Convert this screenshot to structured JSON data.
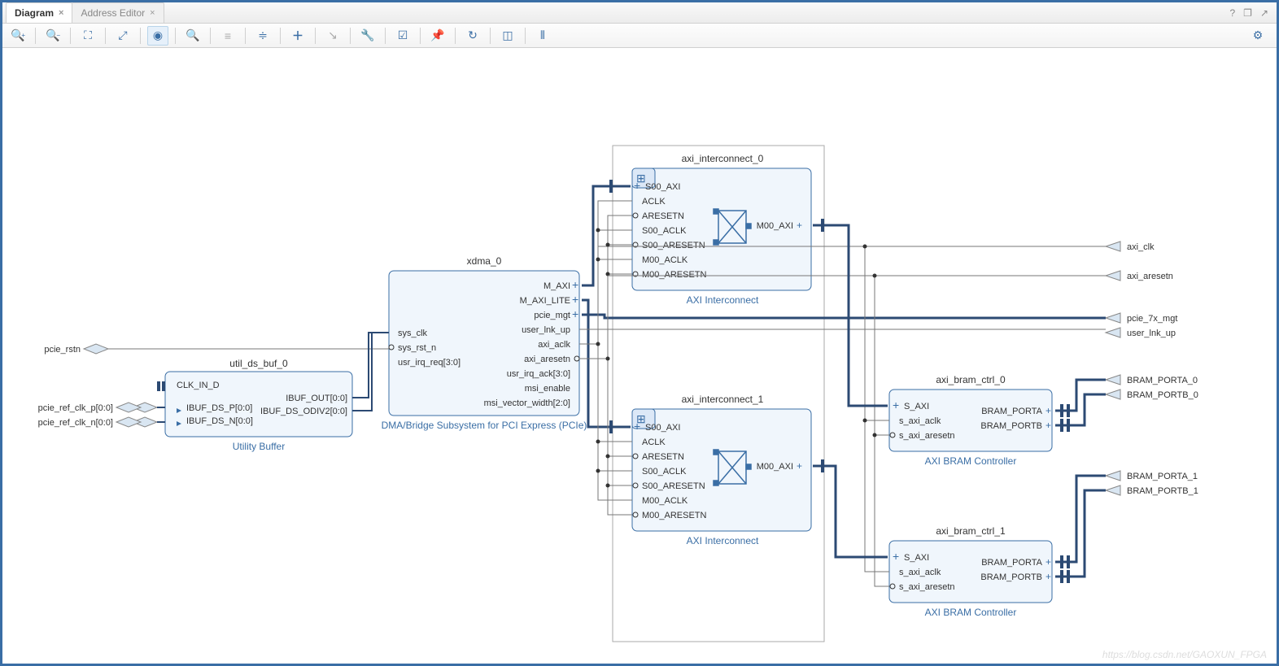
{
  "tabs": [
    {
      "label": "Diagram",
      "active": true
    },
    {
      "label": "Address Editor",
      "active": false
    }
  ],
  "toolbar": {
    "titles": [
      "Zoom In",
      "Zoom Out",
      "Fit",
      "Expand",
      "Center",
      "Search",
      "Collapse",
      "Arrange",
      "Add IP",
      "Connect",
      "Settings",
      "Validate",
      "Pin",
      "Refresh",
      "Highlight",
      "Group"
    ],
    "gear": "Settings"
  },
  "ext_ports": {
    "pcie_rstn": "pcie_rstn",
    "pcie_ref_clk_p": "pcie_ref_clk_p[0:0]",
    "pcie_ref_clk_n": "pcie_ref_clk_n[0:0]",
    "axi_clk": "axi_clk",
    "axi_aresetn": "axi_aresetn",
    "pcie_7x_mgt": "pcie_7x_mgt",
    "user_lnk_up": "user_lnk_up",
    "bram_porta_0": "BRAM_PORTA_0",
    "bram_portb_0": "BRAM_PORTB_0",
    "bram_porta_1": "BRAM_PORTA_1",
    "bram_portb_1": "BRAM_PORTB_1"
  },
  "blocks": {
    "util_ds_buf": {
      "title": "util_ds_buf_0",
      "type": "Utility Buffer",
      "left": [
        "CLK_IN_D",
        "IBUF_DS_P[0:0]",
        "IBUF_DS_N[0:0]"
      ],
      "right": [
        "IBUF_OUT[0:0]",
        "IBUF_DS_ODIV2[0:0]"
      ]
    },
    "xdma": {
      "title": "xdma_0",
      "type": "DMA/Bridge Subsystem for PCI Express (PCIe)",
      "left": [
        "sys_clk",
        "sys_rst_n",
        "usr_irq_req[3:0]"
      ],
      "right": [
        "M_AXI",
        "M_AXI_LITE",
        "pcie_mgt",
        "user_lnk_up",
        "axi_aclk",
        "axi_aresetn",
        "usr_irq_ack[3:0]",
        "msi_enable",
        "msi_vector_width[2:0]"
      ]
    },
    "axi_ic0": {
      "title": "axi_interconnect_0",
      "type": "AXI Interconnect",
      "left": [
        "S00_AXI",
        "ACLK",
        "ARESETN",
        "S00_ACLK",
        "S00_ARESETN",
        "M00_ACLK",
        "M00_ARESETN"
      ],
      "right": [
        "M00_AXI"
      ]
    },
    "axi_ic1": {
      "title": "axi_interconnect_1",
      "type": "AXI Interconnect",
      "left": [
        "S00_AXI",
        "ACLK",
        "ARESETN",
        "S00_ACLK",
        "S00_ARESETN",
        "M00_ACLK",
        "M00_ARESETN"
      ],
      "right": [
        "M00_AXI"
      ]
    },
    "bram_ctrl0": {
      "title": "axi_bram_ctrl_0",
      "type": "AXI BRAM Controller",
      "left": [
        "S_AXI",
        "s_axi_aclk",
        "s_axi_aresetn"
      ],
      "right": [
        "BRAM_PORTA",
        "BRAM_PORTB"
      ]
    },
    "bram_ctrl1": {
      "title": "axi_bram_ctrl_1",
      "type": "AXI BRAM Controller",
      "left": [
        "S_AXI",
        "s_axi_aclk",
        "s_axi_aresetn"
      ],
      "right": [
        "BRAM_PORTA",
        "BRAM_PORTB"
      ]
    }
  },
  "watermark": "https://blog.csdn.net/GAOXUN_FPGA"
}
